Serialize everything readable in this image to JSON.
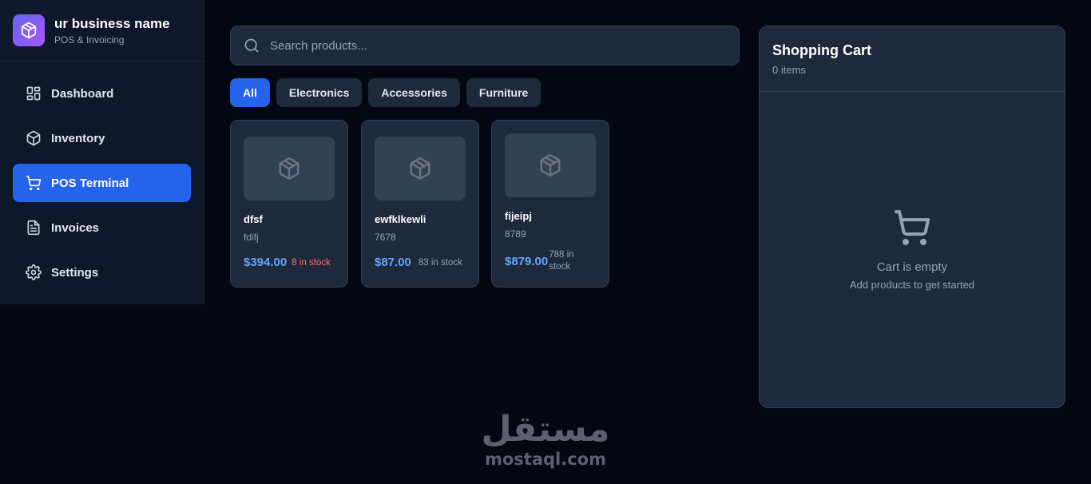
{
  "brand": {
    "name": "ur business name",
    "subtitle": "POS & Invoicing"
  },
  "sidebar": {
    "items": [
      {
        "label": "Dashboard",
        "icon": "dashboard-icon"
      },
      {
        "label": "Inventory",
        "icon": "box-icon"
      },
      {
        "label": "POS Terminal",
        "icon": "cart-icon",
        "active": true
      },
      {
        "label": "Invoices",
        "icon": "document-icon"
      },
      {
        "label": "Settings",
        "icon": "gear-icon"
      }
    ]
  },
  "search": {
    "placeholder": "Search products...",
    "value": ""
  },
  "categories": [
    {
      "label": "All",
      "active": true
    },
    {
      "label": "Electronics"
    },
    {
      "label": "Accessories"
    },
    {
      "label": "Furniture"
    }
  ],
  "products": [
    {
      "name": "dfsf",
      "sku": "fdifj",
      "price": "$394.00",
      "stock": "8 in stock",
      "low_stock": true
    },
    {
      "name": "ewfklkewli",
      "sku": "7678",
      "price": "$87.00",
      "stock": "83 in stock"
    },
    {
      "name": "fijeipj",
      "sku": "8789",
      "price": "$879.00",
      "stock": "788 in stock"
    }
  ],
  "cart": {
    "title": "Shopping Cart",
    "count": "0 items",
    "empty_title": "Cart is empty",
    "empty_sub": "Add products to get started"
  },
  "watermark": {
    "arabic": "مستقل",
    "latin": "mostaql.com"
  },
  "colors": {
    "accent": "#2563eb",
    "brand_gradient_start": "#6366f1",
    "brand_gradient_end": "#a855f7",
    "price": "#60a5fa",
    "low_stock": "#f87171"
  }
}
